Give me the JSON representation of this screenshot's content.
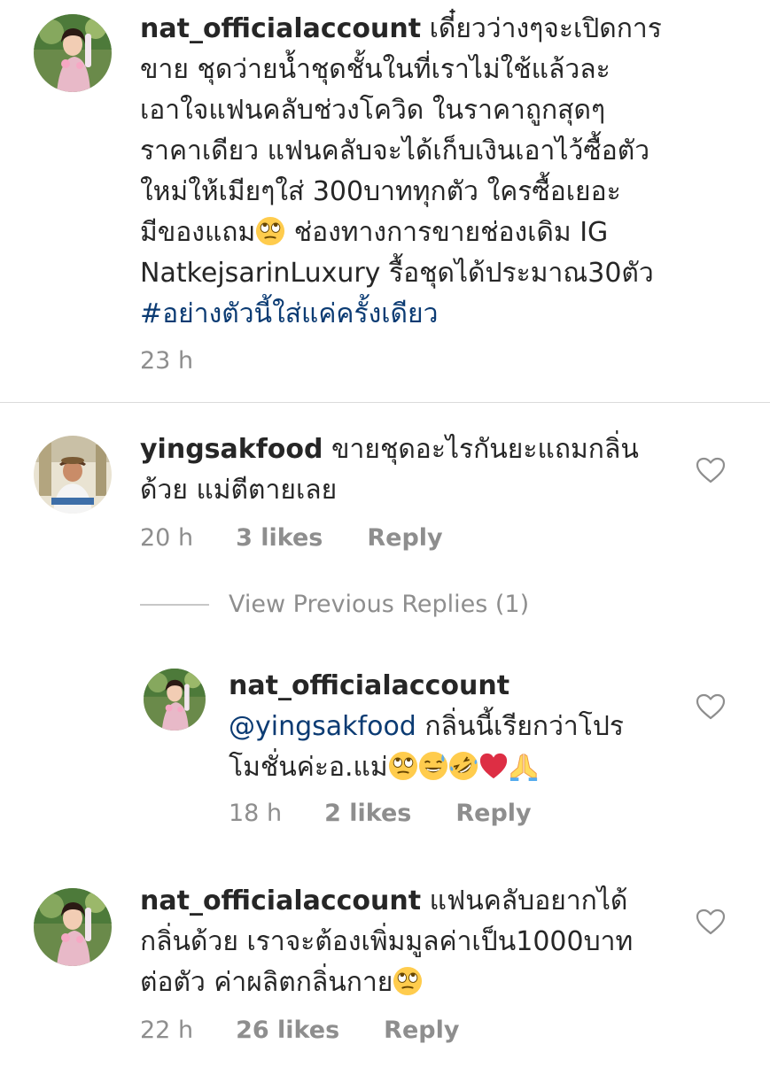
{
  "comments": [
    {
      "username": "nat_officialaccount",
      "text_lines": [
        "เดี๋ยวว่างๆจะเปิดการ",
        "ขาย ชุดว่ายน้ำชุดชั้นในที่เราไม่ใช้แล้วละ",
        "เอาใจแฟนคลับช่วงโควิด ในราคาถูกสุดๆ",
        "ราคาเดียว แฟนคลับจะได้เก็บเงินเอาไว้ซื้อตัว",
        "ใหม่ให้เมียๆใส่ 300บาททุกตัว ใครซื้อเยอะ",
        "มีของแถม",
        " ช่องทางการขายช่องเดิม IG",
        "NatkejsarinLuxury รื้อชุดได้ประมาณ30ตัว"
      ],
      "hashtag": "#อย่างตัวนี้ใส่แค่ครั้งเดียว",
      "time": "23 h"
    },
    {
      "username": "yingsakfood",
      "text_line1": "ขายชุดอะไรกันยะแถมกลิ่น",
      "text_line2": "ด้วย แม่ตีตายเลย",
      "time": "20 h",
      "likes": "3 likes",
      "reply": "Reply"
    },
    {
      "username": "nat_officialaccount",
      "mention": "@yingsakfood",
      "text_line1": "กลิ่นนี้เรียกว่าโปร",
      "text_line2": "โมชั่นค่ะอ.แม่",
      "time": "18 h",
      "likes": "2 likes",
      "reply": "Reply"
    },
    {
      "username": "nat_officialaccount",
      "text_line1": "แฟนคลับอยากได้",
      "text_line2": "กลิ่นด้วย เราจะต้องเพิ่มมูลค่าเป็น1000บาท",
      "text_line3": "ต่อตัว ค่าผลิตกลิ่นกาย",
      "time": "22 h",
      "likes": "26 likes",
      "reply": "Reply"
    }
  ],
  "view_previous_replies": "View Previous Replies (1)",
  "icons": {
    "like": "heart-outline-icon",
    "emoji_eyeroll": "face-with-rolling-eyes-emoji",
    "emoji_sweat": "grinning-face-with-sweat-emoji",
    "emoji_rofl": "rolling-on-floor-laughing-emoji",
    "emoji_heart": "red-heart-emoji",
    "emoji_pray": "folded-hands-emoji"
  },
  "colors": {
    "text": "#262626",
    "meta": "#8e8e8e",
    "link": "#0b3b73",
    "divider": "#dbdbdb"
  }
}
